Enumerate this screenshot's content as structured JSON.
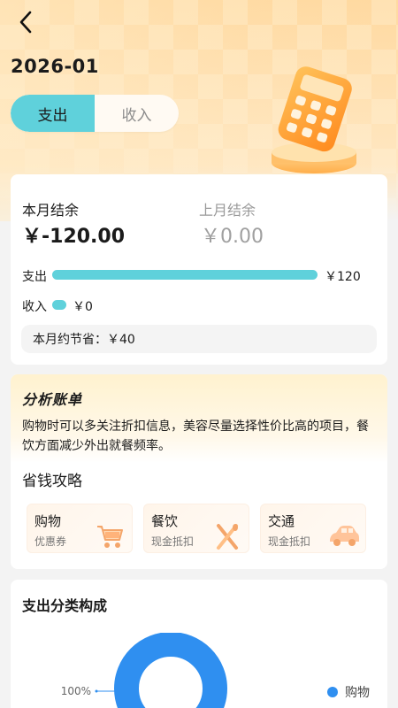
{
  "header": {
    "month": "2026-01",
    "tabs": [
      "支出",
      "收入"
    ],
    "active_tab": 0
  },
  "summary": {
    "this_month_label": "本月结余",
    "this_month_value": "￥-120.00",
    "last_month_label": "上月结余",
    "last_month_value": "￥0.00",
    "expense_label": "支出",
    "expense_value": "￥120",
    "expense_fraction": 1.0,
    "income_label": "收入",
    "income_value": "￥0",
    "income_fraction": 0.0,
    "saving_text": "本月约节省：￥40"
  },
  "analysis": {
    "title": "分析账单",
    "text": "购物时可以多关注折扣信息，美容尽量选择性价比高的项目，餐饮方面减少外出就餐频率。",
    "tips_title": "省钱攻略",
    "tips": [
      {
        "title": "购物",
        "sub": "优惠券",
        "icon": "cart-icon"
      },
      {
        "title": "餐饮",
        "sub": "现金抵扣",
        "icon": "utensils-icon"
      },
      {
        "title": "交通",
        "sub": "现金抵扣",
        "icon": "car-icon"
      }
    ]
  },
  "category": {
    "title": "支出分类构成",
    "legend": [
      {
        "name": "购物",
        "color": "#2f8ff0"
      }
    ]
  },
  "chart_data": {
    "type": "pie",
    "categories": [
      "购物"
    ],
    "values": [
      100
    ],
    "labels": [
      "100%"
    ]
  },
  "colors": {
    "accent": "#5fd1db",
    "donut": "#2f8ff0"
  }
}
